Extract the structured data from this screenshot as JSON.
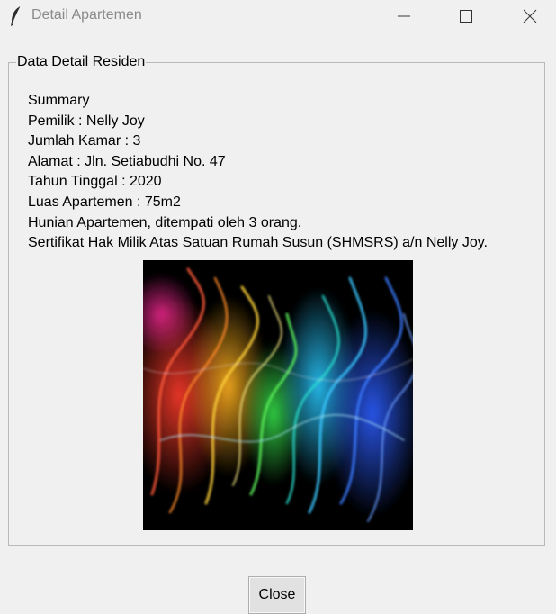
{
  "window": {
    "title": "Detail Apartemen",
    "app_icon": "feather-icon",
    "controls": [
      "minimize-icon",
      "maximize-icon",
      "close-icon"
    ]
  },
  "group": {
    "legend": "Data Detail Residen"
  },
  "details": {
    "summary": "Summary",
    "owner": "Pemilik : Nelly Joy",
    "rooms": "Jumlah Kamar : 3",
    "address": "Alamat : Jln. Setiabudhi No. 47",
    "year": "Tahun Tinggal : 2020",
    "area": "Luas Apartemen : 75m2",
    "occupancy": "Hunian Apartemen, ditempati oleh 3 orang.",
    "certificate": "Sertifikat Hak Milik Atas Satuan Rumah Susun (SHMSRS) a/n Nelly Joy."
  },
  "picture": {
    "subject": "colorful smoke on black background"
  },
  "buttons": {
    "close_label": "Close"
  }
}
